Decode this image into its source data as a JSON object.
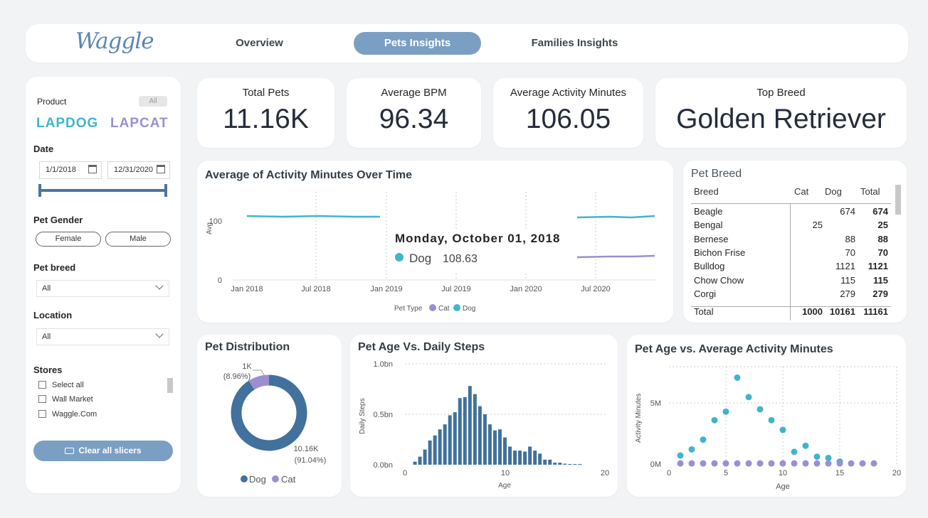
{
  "header": {
    "logo": "Waggle",
    "tabs": [
      "Overview",
      "Pets Insights",
      "Families Insights"
    ]
  },
  "sidebar": {
    "product_label": "Product",
    "product_all": "All",
    "brands": [
      "LAPDOG",
      "LAPCAT"
    ],
    "date_label": "Date",
    "date_start": "1/1/2018",
    "date_end": "12/31/2020",
    "gender_label": "Pet Gender",
    "genders": [
      "Female",
      "Male"
    ],
    "breed_label": "Pet breed",
    "breed_value": "All",
    "location_label": "Location",
    "location_value": "All",
    "stores_label": "Stores",
    "stores": [
      "Select all",
      "Wall Market",
      "Waggle.Com"
    ],
    "clear_label": "Clear all slicers"
  },
  "kpis": {
    "total_pets": {
      "title": "Total Pets",
      "value": "11.16K"
    },
    "avg_bpm": {
      "title": "Average BPM",
      "value": "96.34"
    },
    "avg_activity": {
      "title": "Average Activity Minutes",
      "value": "106.05"
    },
    "top_breed": {
      "title": "Top Breed",
      "value": "Golden Retriever"
    }
  },
  "colors": {
    "dog": "#3fb5cc",
    "cat": "#9b8fd1",
    "bar": "#41719c",
    "accent": "#7a9fc3"
  },
  "chart_data": [
    {
      "type": "line",
      "title": "Average of Activity Minutes Over Time",
      "ylabel": "Avg",
      "x_ticks": [
        "Jan 2018",
        "Jul 2018",
        "Jan 2019",
        "Jul 2019",
        "Jan 2020",
        "Jul 2020"
      ],
      "y_ticks": [
        "0",
        "100"
      ],
      "legend_title": "Pet Type",
      "series": [
        {
          "name": "Cat"
        },
        {
          "name": "Dog"
        }
      ],
      "tooltip": {
        "date": "Monday, October 01, 2018",
        "series": "Dog",
        "value": "108.63"
      }
    },
    {
      "type": "table",
      "title": "Pet Breed",
      "columns": [
        "Breed",
        "Cat",
        "Dog",
        "Total"
      ],
      "rows": [
        [
          "Beagle",
          "",
          "674",
          "674"
        ],
        [
          "Bengal",
          "25",
          "",
          "25"
        ],
        [
          "Bernese",
          "",
          "88",
          "88"
        ],
        [
          "Bichon Frise",
          "",
          "70",
          "70"
        ],
        [
          "Bulldog",
          "",
          "1121",
          "1121"
        ],
        [
          "Chow Chow",
          "",
          "115",
          "115"
        ],
        [
          "Corgi",
          "",
          "279",
          "279"
        ]
      ],
      "total": [
        "Total",
        "1000",
        "10161",
        "11161"
      ]
    },
    {
      "type": "pie",
      "title": "Pet Distribution",
      "labels": [
        "Dog",
        "Cat"
      ],
      "values": [
        10160,
        1000
      ],
      "data_labels": [
        [
          "10.16K",
          "(91.04%)"
        ],
        [
          "1K",
          "(8.96%)"
        ]
      ]
    },
    {
      "type": "bar",
      "title": "Pet Age Vs. Daily Steps",
      "xlabel": "Age",
      "ylabel": "Daily Steps",
      "x_ticks": [
        "0",
        "10",
        "20"
      ],
      "y_ticks": [
        "0.0bn",
        "0.5bn",
        "1.0bn"
      ],
      "ylim": [
        0,
        1.0
      ],
      "x": [
        1,
        1.5,
        2,
        2.5,
        3,
        3.5,
        4,
        4.5,
        5,
        5.5,
        6,
        6.5,
        7,
        7.5,
        8,
        8.5,
        9,
        9.5,
        10,
        10.5,
        11,
        11.5,
        12,
        12.5,
        13,
        13.5,
        14,
        14.5,
        15,
        15.5,
        16,
        16.5,
        17,
        17.5
      ],
      "values": [
        0.03,
        0.08,
        0.15,
        0.24,
        0.29,
        0.35,
        0.4,
        0.49,
        0.52,
        0.66,
        0.67,
        0.78,
        0.7,
        0.58,
        0.5,
        0.4,
        0.34,
        0.35,
        0.27,
        0.18,
        0.14,
        0.14,
        0.13,
        0.18,
        0.14,
        0.11,
        0.05,
        0.05,
        0.02,
        0.02,
        0.01,
        0.005,
        0.005,
        0.005
      ]
    },
    {
      "type": "scatter",
      "title": "Pet Age vs. Average Activity Minutes",
      "xlabel": "Age",
      "ylabel": "Activity Minutes",
      "x_ticks": [
        "0",
        "5",
        "10",
        "15",
        "20"
      ],
      "y_ticks": [
        "0M",
        "5M"
      ],
      "xlim": [
        0,
        20
      ],
      "ylim": [
        0,
        8
      ],
      "series": [
        {
          "name": "Dog",
          "x": [
            1,
            2,
            3,
            4,
            5,
            6,
            7,
            8,
            9,
            10,
            11,
            12,
            13,
            14,
            15
          ],
          "y": [
            0.7,
            1.2,
            2.0,
            3.6,
            4.3,
            7.1,
            5.5,
            4.5,
            3.6,
            2.8,
            1.0,
            1.5,
            0.6,
            0.5,
            0.2
          ]
        },
        {
          "name": "Cat",
          "x": [
            1,
            2,
            3,
            4,
            5,
            6,
            7,
            8,
            9,
            10,
            11,
            12,
            13,
            14,
            15,
            16,
            17,
            18
          ],
          "y": [
            0.05,
            0.05,
            0.05,
            0.05,
            0.05,
            0.05,
            0.05,
            0.05,
            0.05,
            0.05,
            0.05,
            0.05,
            0.05,
            0.05,
            0.05,
            0.05,
            0.05,
            0.05
          ]
        }
      ]
    }
  ]
}
